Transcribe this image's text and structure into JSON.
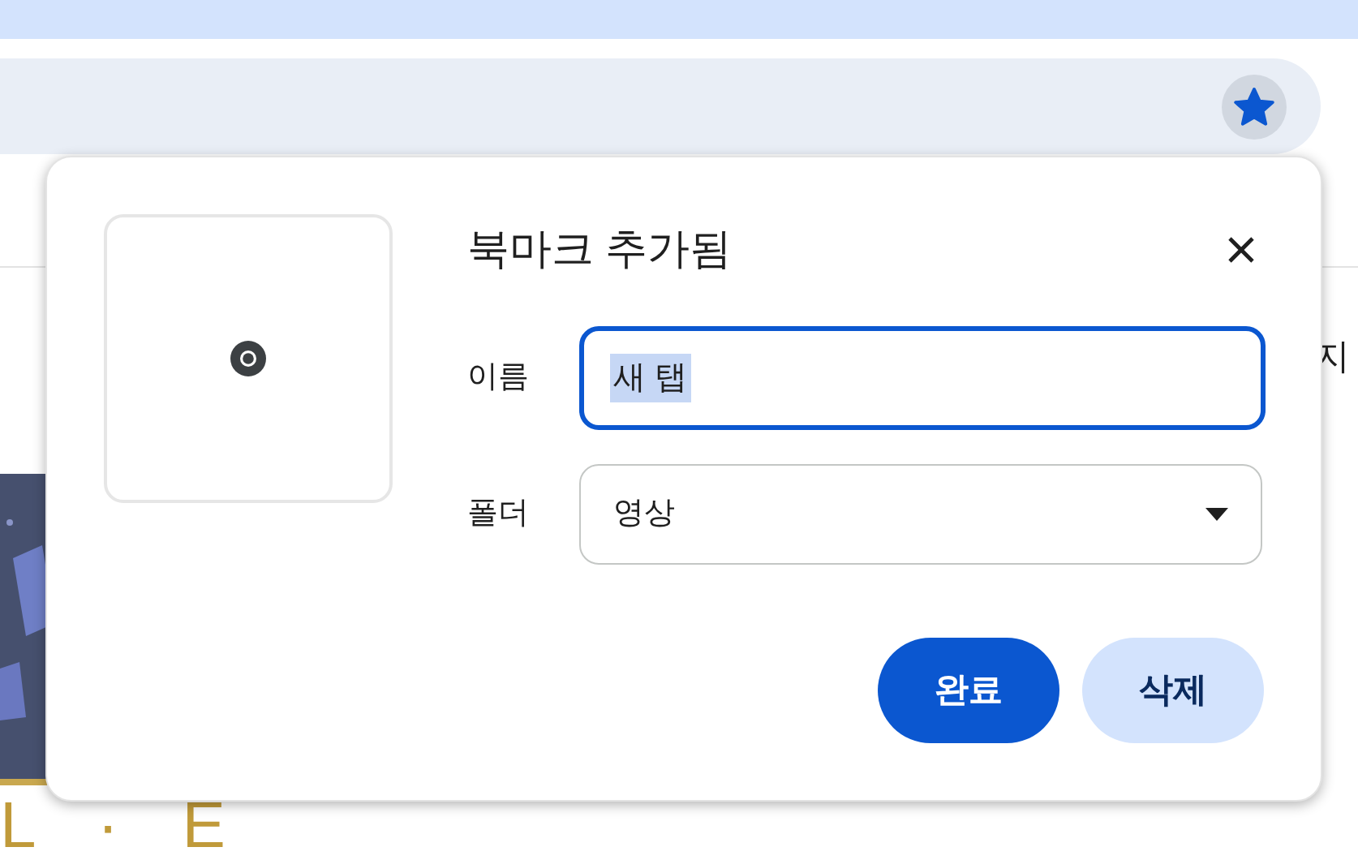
{
  "address_bar": {
    "bookmarked": true
  },
  "page": {
    "side_text": "지",
    "logo_text": "L · E"
  },
  "dialog": {
    "title": "북마크 추가됨",
    "fields": [
      {
        "kind": "text",
        "label": "이름",
        "value": "새 탭",
        "focused": true,
        "selected": true
      },
      {
        "kind": "dropdown",
        "label": "폴더",
        "value": "영상",
        "focused": false,
        "selected": false
      }
    ],
    "buttons": [
      {
        "kind": "primary",
        "label": "완료"
      },
      {
        "kind": "secondary",
        "label": "삭제"
      }
    ]
  }
}
